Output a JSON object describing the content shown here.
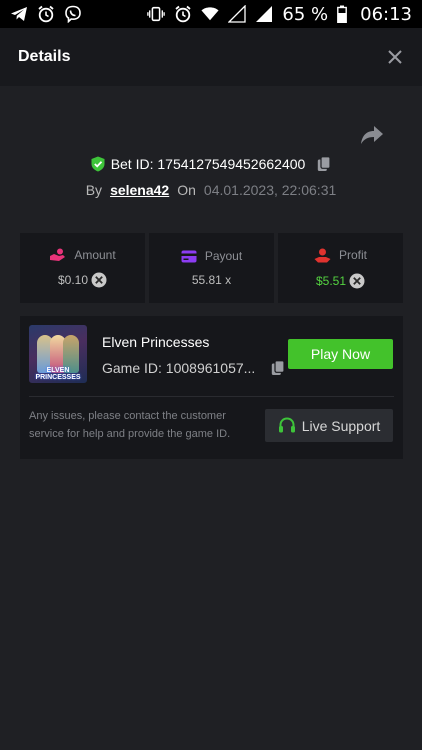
{
  "status_bar": {
    "left_icons": [
      "telegram-icon",
      "alarm-icon",
      "viber-icon"
    ],
    "right_icons": [
      "vibrate-icon",
      "alarm-icon",
      "wifi-icon",
      "signal-empty-icon",
      "signal-icon"
    ],
    "battery_text": "65 %",
    "time": "06:13"
  },
  "header": {
    "title": "Details",
    "close_icon": "close-icon"
  },
  "bet": {
    "id_text": "Bet ID: 1754127549452662400",
    "by_label": "By",
    "username": "selena42",
    "on_label": "On",
    "date": "04.01.2023, 22:06:31"
  },
  "stats": [
    {
      "label": "Amount",
      "value": "$0.10",
      "icon": "amount-icon",
      "coin": true,
      "green": false
    },
    {
      "label": "Payout",
      "value": "55.81 x",
      "icon": "payout-icon",
      "coin": false,
      "green": false
    },
    {
      "label": "Profit",
      "value": "$5.51",
      "icon": "profit-icon",
      "coin": true,
      "green": true
    }
  ],
  "game": {
    "name": "Elven Princesses",
    "id_text": "Game ID: 1008961057...",
    "play_label": "Play Now",
    "thumb_caption_1": "ELVEN",
    "thumb_caption_2": "PRINCESSES",
    "help_text": "Any issues, please contact the customer service for help and provide the game ID.",
    "support_label": "Live Support"
  },
  "colors": {
    "accent_green": "#43c22b",
    "profit_green": "#54d340",
    "background": "#1f2024",
    "card": "#16171b"
  }
}
